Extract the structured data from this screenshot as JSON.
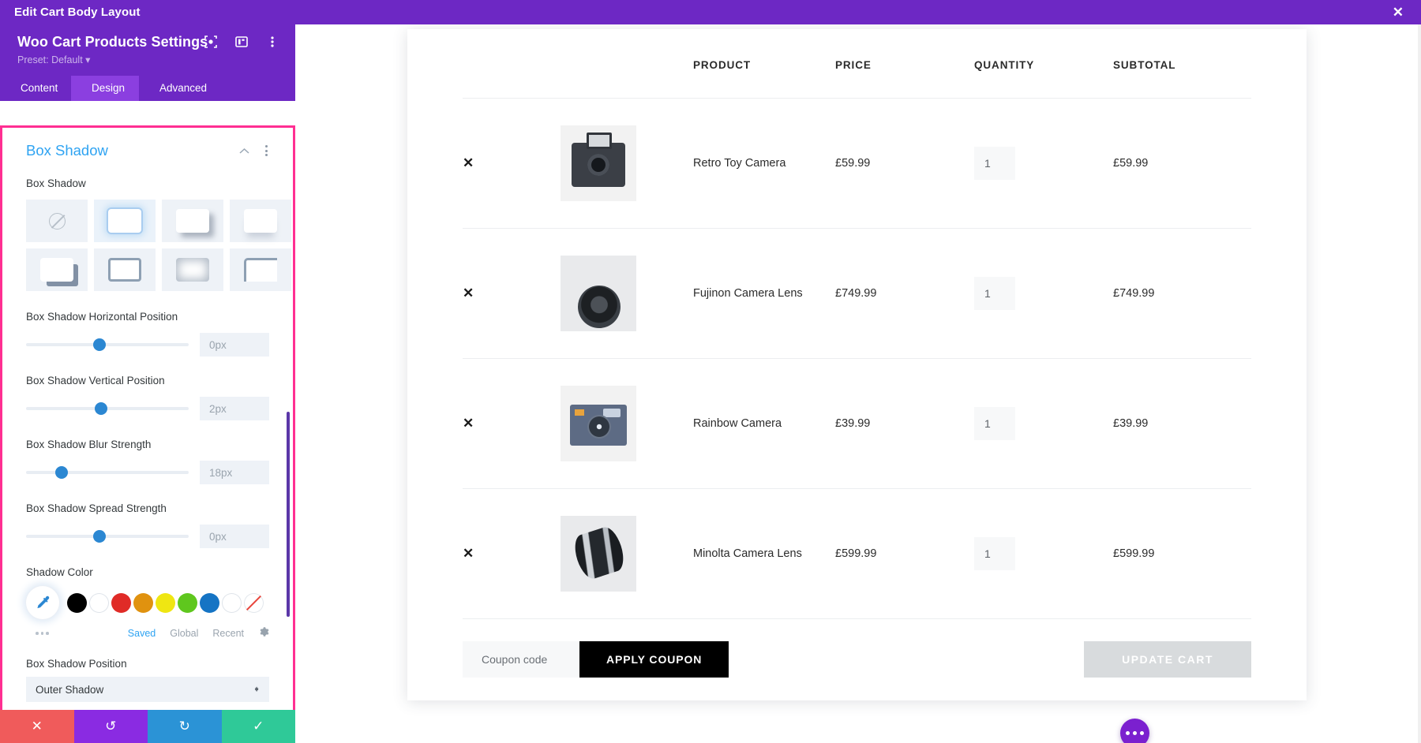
{
  "topbar": {
    "title": "Edit Cart Body Layout",
    "close_icon": "close-icon"
  },
  "panel": {
    "title": "Woo Cart Products Settings",
    "preset": "Preset: Default",
    "preset_caret": "▾",
    "head_icons": [
      "target-icon",
      "layout-icon",
      "kebab-menu-icon"
    ],
    "tabs": [
      {
        "label": "Content",
        "active": false
      },
      {
        "label": "Design",
        "active": true
      },
      {
        "label": "Advanced",
        "active": false
      }
    ],
    "section": {
      "title": "Box Shadow",
      "collapse_icon": "chevron-up-icon",
      "menu_icon": "kebab-menu-icon",
      "field_label": "Box Shadow",
      "presets": [
        {
          "name": "none",
          "selected": false
        },
        {
          "name": "glow",
          "selected": true
        },
        {
          "name": "drop-right",
          "selected": false
        },
        {
          "name": "drop-bottom",
          "selected": false
        },
        {
          "name": "hard-offset",
          "selected": false
        },
        {
          "name": "outline",
          "selected": false
        },
        {
          "name": "inner",
          "selected": false
        },
        {
          "name": "corner",
          "selected": false
        }
      ],
      "sliders": [
        {
          "label": "Box Shadow Horizontal Position",
          "value": "0px",
          "pos": 45
        },
        {
          "label": "Box Shadow Vertical Position",
          "value": "2px",
          "pos": 46
        },
        {
          "label": "Box Shadow Blur Strength",
          "value": "18px",
          "pos": 22
        },
        {
          "label": "Box Shadow Spread Strength",
          "value": "0px",
          "pos": 45
        }
      ],
      "color": {
        "label": "Shadow Color",
        "eyedropper_icon": "eyedropper-icon",
        "swatches": [
          "#000000",
          "#ffffff",
          "#e02b27",
          "#e0920f",
          "#efe612",
          "#5fc71e",
          "#1574c4",
          "#ffffff",
          "none"
        ],
        "tabs": [
          {
            "label": "Saved",
            "active": true
          },
          {
            "label": "Global",
            "active": false
          },
          {
            "label": "Recent",
            "active": false
          }
        ],
        "settings_icon": "gear-icon",
        "more_icon": "more-dots-icon"
      },
      "position": {
        "label": "Box Shadow Position",
        "value": "Outer Shadow"
      }
    },
    "actions": [
      {
        "name": "cancel",
        "icon": "✕"
      },
      {
        "name": "undo",
        "icon": "↺"
      },
      {
        "name": "redo",
        "icon": "↻"
      },
      {
        "name": "save",
        "icon": "✓"
      }
    ]
  },
  "cart": {
    "headers": [
      "",
      "",
      "PRODUCT",
      "PRICE",
      "QUANTITY",
      "SUBTOTAL"
    ],
    "rows": [
      {
        "remove": "✕",
        "image": "retro-toy-camera",
        "name": "Retro Toy Camera",
        "price": "£59.99",
        "qty": "1",
        "subtotal": "£59.99"
      },
      {
        "remove": "✕",
        "image": "fujinon-camera-lens",
        "name": "Fujinon Camera Lens",
        "price": "£749.99",
        "qty": "1",
        "subtotal": "£749.99"
      },
      {
        "remove": "✕",
        "image": "rainbow-camera",
        "name": "Rainbow Camera",
        "price": "£39.99",
        "qty": "1",
        "subtotal": "£39.99"
      },
      {
        "remove": "✕",
        "image": "minolta-camera-lens",
        "name": "Minolta Camera Lens",
        "price": "£599.99",
        "qty": "1",
        "subtotal": "£599.99"
      }
    ],
    "coupon_placeholder": "Coupon code",
    "coupon_value": "",
    "apply_coupon": "APPLY COUPON",
    "update_cart": "UPDATE CART"
  },
  "fab": {
    "name": "more-options-fab"
  },
  "colors": {
    "brand_purple": "#6d28c4",
    "accent_blue": "#2ea3f2",
    "highlight_pink": "#ff2f92"
  }
}
